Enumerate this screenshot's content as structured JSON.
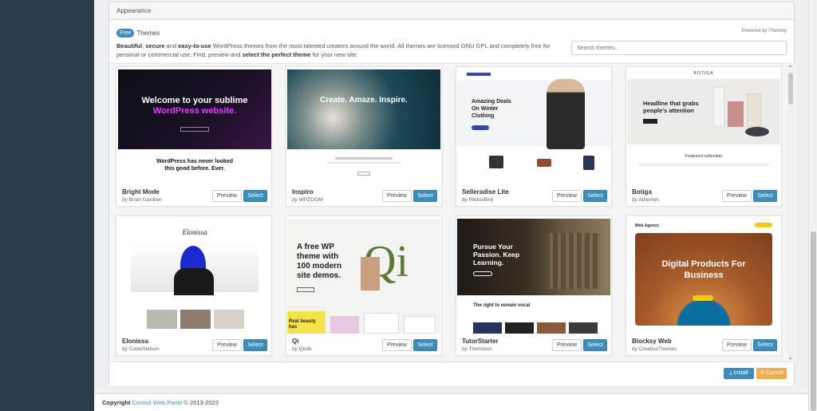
{
  "panel": {
    "title": "Appearance"
  },
  "header": {
    "badge": "Free",
    "title": "Themes",
    "powered_by": "Powered by Themely",
    "desc_1": "Beautiful",
    "desc_2": ", ",
    "desc_3": "secure",
    "desc_4": " and ",
    "desc_5": "easy-to-use",
    "desc_6": " WordPress themes from the most talented creators around the world. All themes are licensed GNU GPL and completely free for personal or commercial use. Find, preview and ",
    "desc_7": "select the perfect theme",
    "desc_8": " for your new site."
  },
  "search": {
    "placeholder": "Search themes..."
  },
  "buttons": {
    "preview": "Preview",
    "select": "Select",
    "install": "Install",
    "cancel": "Cancel"
  },
  "themes": [
    {
      "name": "Bright Mode",
      "by": "by",
      "author": "Brian Gardner"
    },
    {
      "name": "Inspiro",
      "by": "by",
      "author": "WPZOOM"
    },
    {
      "name": "Selleradise Lite",
      "by": "by",
      "author": "RedoxBird"
    },
    {
      "name": "Botiga",
      "by": "by",
      "author": "Athemes"
    },
    {
      "name": "Elonissa",
      "by": "by",
      "author": "CoderNelson"
    },
    {
      "name": "Qi",
      "by": "by",
      "author": "Qode"
    },
    {
      "name": "TutorStarter",
      "by": "by",
      "author": "Themeum"
    },
    {
      "name": "Blocksy Web",
      "by": "by",
      "author": "CreativeThemes"
    }
  ],
  "thumb_text": {
    "bright_h1": "Welcome to your sublime",
    "bright_h2": "WordPress website.",
    "bright_h3": "WordPress has never looked",
    "bright_h4": "this good before. Ever.",
    "inspiro_h": "Create. Amaze. Inspire.",
    "seller_h": "Amazing Deals On Winter Clothing",
    "botiga_h": "Headline that grabs people's attention",
    "botiga_logo": "BOTIGA",
    "botiga_fc": "Featured collection",
    "elonissa_logo": "Elonissa",
    "qi_h": "A free WP theme with 100 modern site demos.",
    "qi_letter": "Qi",
    "qi_real": "Real beauty has",
    "tutor_h": "Pursue Your Passion. Keep Learning.",
    "tutor_sub": "The right to remain vocal",
    "blocksy_h": "Digital Products For Business",
    "blocksy_logo": "Web Agency"
  },
  "footer": {
    "prefix": "Copyright",
    "link": "Control Web Panel",
    "suffix": "© 2013-2023"
  },
  "colors": {
    "primary": "#3c8dbc",
    "cancel": "#f0ad4e",
    "sidebar": "#2c3b4b"
  }
}
